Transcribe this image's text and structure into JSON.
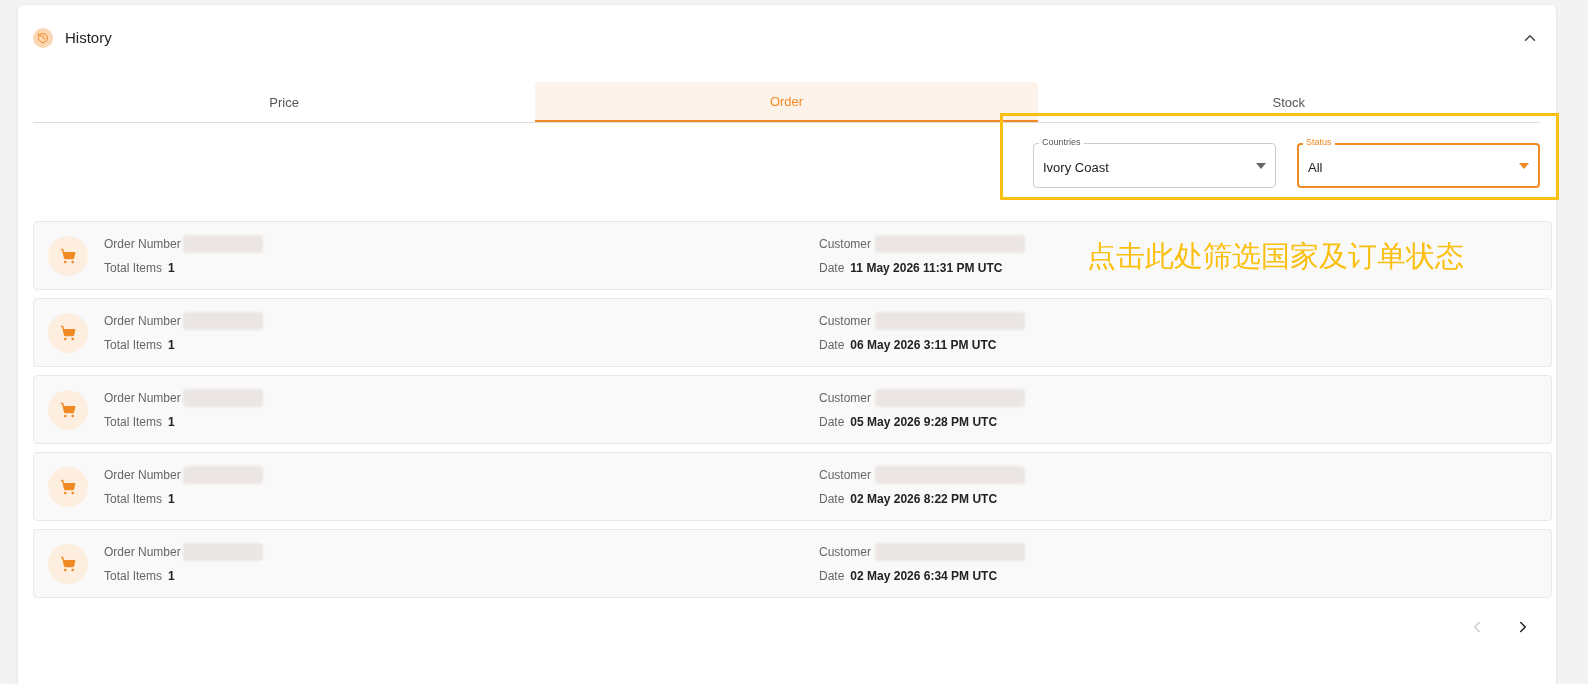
{
  "header": {
    "title": "History",
    "expanded": true
  },
  "tabs": [
    {
      "label": "Price",
      "selected": false
    },
    {
      "label": "Order",
      "selected": true
    },
    {
      "label": "Stock",
      "selected": false
    }
  ],
  "filters": [
    {
      "label": "Countries",
      "value": "Ivory Coast",
      "focused": false
    },
    {
      "label": "Status",
      "value": "All",
      "focused": true
    }
  ],
  "annotation": {
    "text": "点击此处筛选国家及订单状态"
  },
  "orders": [
    {
      "order_label": "Order Number",
      "items_label": "Total Items",
      "items": "1",
      "customer_label": "Customer",
      "date_label": "Date",
      "date": "11 May 2026 11:31 PM UTC"
    },
    {
      "order_label": "Order Number",
      "items_label": "Total Items",
      "items": "1",
      "customer_label": "Customer",
      "date_label": "Date",
      "date": "06 May 2026 3:11 PM UTC"
    },
    {
      "order_label": "Order Number",
      "items_label": "Total Items",
      "items": "1",
      "customer_label": "Customer",
      "date_label": "Date",
      "date": "05 May 2026 9:28 PM UTC"
    },
    {
      "order_label": "Order Number",
      "items_label": "Total Items",
      "items": "1",
      "customer_label": "Customer",
      "date_label": "Date",
      "date": "02 May 2026 8:22 PM UTC"
    },
    {
      "order_label": "Order Number",
      "items_label": "Total Items",
      "items": "1",
      "customer_label": "Customer",
      "date_label": "Date",
      "date": "02 May 2026 6:34 PM UTC"
    }
  ],
  "pagination": {
    "previous_disabled": true,
    "next_disabled": false
  }
}
